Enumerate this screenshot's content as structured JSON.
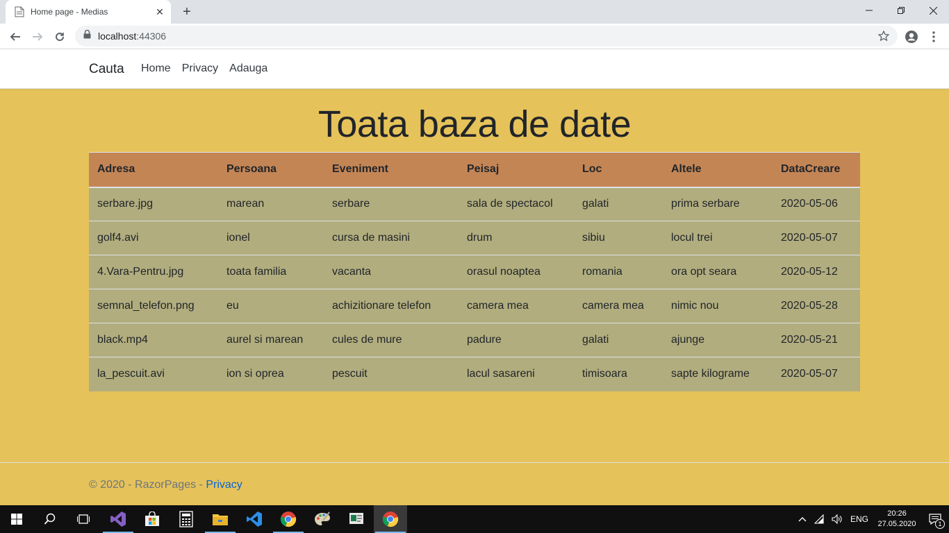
{
  "browser": {
    "tab_title": "Home page - Medias",
    "url_host": "localhost",
    "url_port": ":44306"
  },
  "navbar": {
    "brand": "Cauta",
    "links": [
      "Home",
      "Privacy",
      "Adauga"
    ]
  },
  "main": {
    "title": "Toata baza de date",
    "table": {
      "headers": [
        "Adresa",
        "Persoana",
        "Eveniment",
        "Peisaj",
        "Loc",
        "Altele",
        "DataCreare"
      ],
      "rows": [
        [
          "serbare.jpg",
          "marean",
          "serbare",
          "sala de spectacol",
          "galati",
          "prima serbare",
          "2020-05-06"
        ],
        [
          "golf4.avi",
          "ionel",
          "cursa de masini",
          "drum",
          "sibiu",
          "locul trei",
          "2020-05-07"
        ],
        [
          "4.Vara-Pentru.jpg",
          "toata familia",
          "vacanta",
          "orasul noaptea",
          "romania",
          "ora opt seara",
          "2020-05-12"
        ],
        [
          "semnal_telefon.png",
          "eu",
          "achizitionare telefon",
          "camera mea",
          "camera mea",
          "nimic nou",
          "2020-05-28"
        ],
        [
          "black.mp4",
          "aurel si marean",
          "cules de mure",
          "padure",
          "galati",
          "ajunge",
          "2020-05-21"
        ],
        [
          "la_pescuit.avi",
          "ion si oprea",
          "pescuit",
          "lacul sasareni",
          "timisoara",
          "sapte kilograme",
          "2020-05-07"
        ]
      ]
    }
  },
  "footer": {
    "text": "© 2020 - RazorPages - ",
    "link": "Privacy"
  },
  "taskbar": {
    "lang": "ENG",
    "time": "20:26",
    "date": "27.05.2020",
    "notification_count": "1"
  },
  "colors": {
    "page_bg": "#e6c25a",
    "table_header_bg": "#c48555",
    "table_row_bg": "#b1ad7e"
  }
}
